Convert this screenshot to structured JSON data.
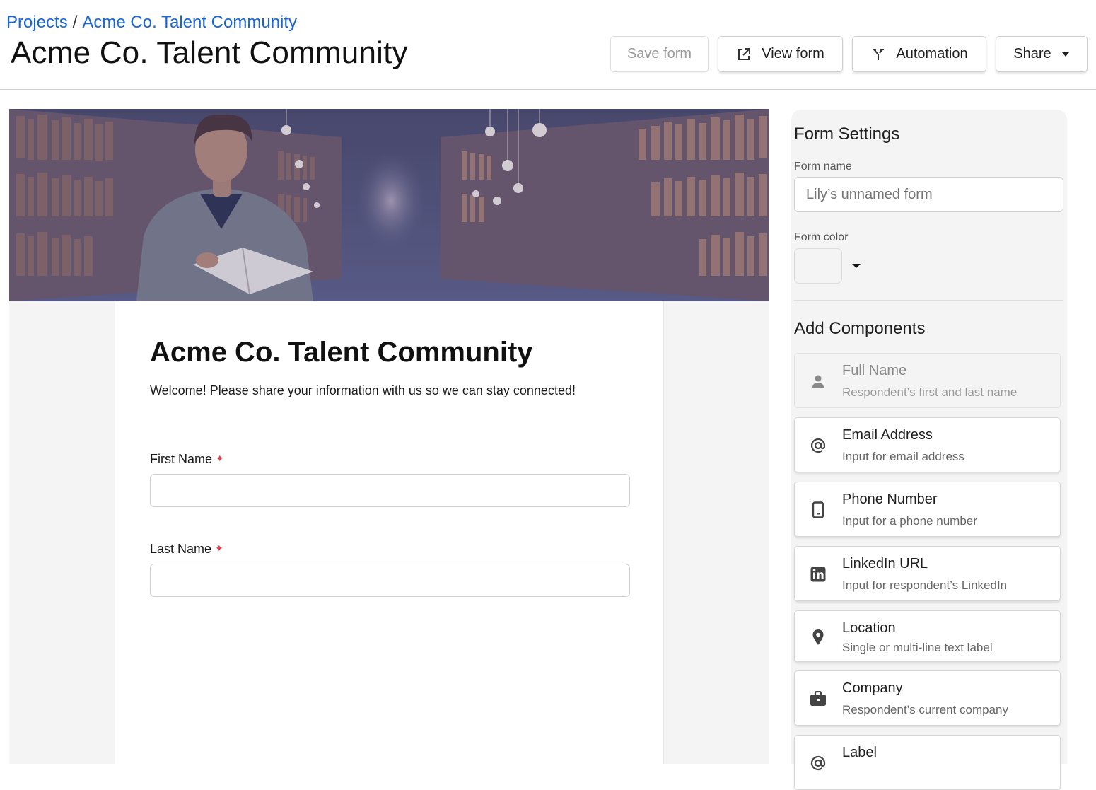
{
  "breadcrumb": {
    "root": "Projects",
    "separator": "/",
    "current": "Acme Co. Talent Community"
  },
  "header": {
    "title": "Acme Co. Talent Community",
    "save_label": "Save form",
    "view_label": "View form",
    "automation_label": "Automation",
    "share_label": "Share"
  },
  "form": {
    "title": "Acme Co. Talent Community",
    "description": "Welcome! Please share your information with us so we can stay connected!",
    "required_marker": "✦",
    "fields": [
      {
        "label": "First Name",
        "value": ""
      },
      {
        "label": "Last Name",
        "value": ""
      }
    ]
  },
  "settings": {
    "heading": "Form Settings",
    "name_label": "Form name",
    "name_placeholder": "Lily’s unnamed form",
    "color_label": "Form color",
    "components_heading": "Add Components",
    "components": [
      {
        "title": "Full Name",
        "subtitle": "Respondent’s first and last name",
        "icon": "person-icon",
        "disabled": true
      },
      {
        "title": "Email Address",
        "subtitle": "Input for email address",
        "icon": "at-icon"
      },
      {
        "title": "Phone Number",
        "subtitle": "Input for a phone number",
        "icon": "phone-icon"
      },
      {
        "title": "LinkedIn URL",
        "subtitle": "Input for respondent’s LinkedIn",
        "icon": "linkedin-icon"
      },
      {
        "title": "Location",
        "subtitle": "Single or multi-line text label",
        "icon": "location-pin-icon"
      },
      {
        "title": "Company",
        "subtitle": "Respondent’s current company",
        "icon": "briefcase-icon"
      },
      {
        "title": "Label",
        "subtitle": "",
        "icon": "at-icon"
      }
    ]
  },
  "colors": {
    "link": "#1a66d6",
    "required": "#e0404a",
    "panel_bg": "#f4f4f4"
  }
}
